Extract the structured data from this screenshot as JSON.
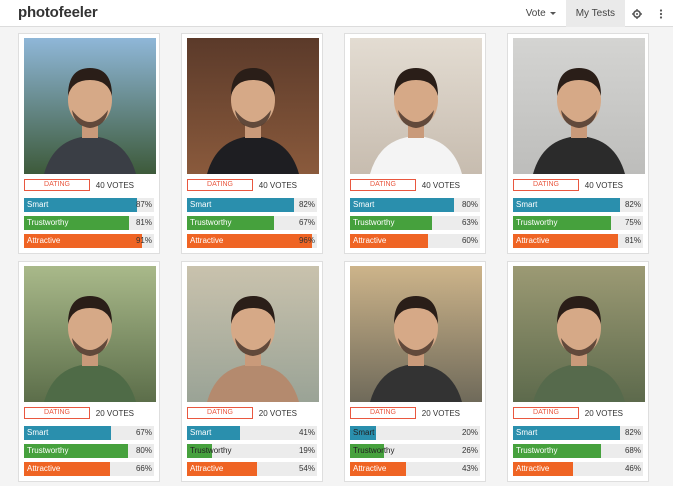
{
  "header": {
    "logo": "photofeeler",
    "vote_label": "Vote",
    "mytests_label": "My Tests"
  },
  "labels": {
    "smart": "Smart",
    "trust": "Trustworthy",
    "attr": "Attractive"
  },
  "photos": [
    {
      "tag": "DATING",
      "votes": "40",
      "smart": 87,
      "trust": 81,
      "attr": 91,
      "bg": [
        "#8fb7d8",
        "#3d5a3a"
      ],
      "shirt": "#3a3e45"
    },
    {
      "tag": "DATING",
      "votes": "40",
      "smart": 82,
      "trust": 67,
      "attr": 96,
      "bg": [
        "#5b3a2a",
        "#8a5a3c"
      ],
      "shirt": "#1e1e22"
    },
    {
      "tag": "DATING",
      "votes": "40",
      "smart": 80,
      "trust": 63,
      "attr": 60,
      "bg": [
        "#e3dcd2",
        "#c7bcaf"
      ],
      "shirt": "#f4f4f4"
    },
    {
      "tag": "DATING",
      "votes": "40",
      "smart": 82,
      "trust": 75,
      "attr": 81,
      "bg": [
        "#d4d4d2",
        "#bdbdbb"
      ],
      "shirt": "#2b2b2b"
    },
    {
      "tag": "DATING",
      "votes": "20",
      "smart": 67,
      "trust": 80,
      "attr": 66,
      "bg": [
        "#a9b98a",
        "#5c6e4a"
      ],
      "shirt": "#4f6b47"
    },
    {
      "tag": "DATING",
      "votes": "20",
      "smart": 41,
      "trust": 19,
      "attr": 54,
      "bg": [
        "#c9c2ad",
        "#9aa396"
      ],
      "shirt": "#b48a6e"
    },
    {
      "tag": "DATING",
      "votes": "20",
      "smart": 20,
      "trust": 26,
      "attr": 43,
      "bg": [
        "#cdb48a",
        "#6f6a5a"
      ],
      "shirt": "#333333"
    },
    {
      "tag": "DATING",
      "votes": "20",
      "smart": 82,
      "trust": 68,
      "attr": 46,
      "bg": [
        "#9c9a74",
        "#5d6a4c"
      ],
      "shirt": "#566a4c"
    }
  ]
}
